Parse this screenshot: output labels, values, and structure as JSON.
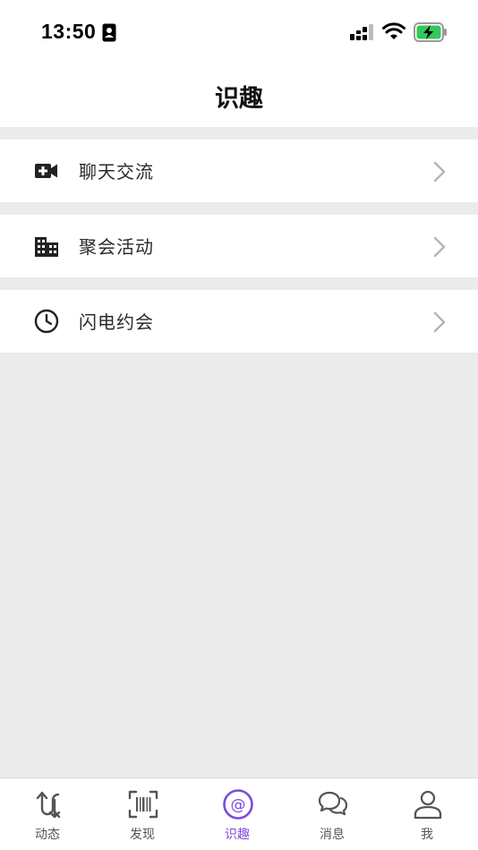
{
  "status_bar": {
    "time": "13:50",
    "icons": [
      "id-card-icon",
      "signal-icon",
      "wifi-icon",
      "battery-charging-icon"
    ],
    "battery_color": "#34c759"
  },
  "nav": {
    "title": "识趣"
  },
  "menu": {
    "items": [
      {
        "label": "聊天交流",
        "icon": "video-add-icon"
      },
      {
        "label": "聚会活动",
        "icon": "building-icon"
      },
      {
        "label": "闪电约会",
        "icon": "clock-icon"
      }
    ]
  },
  "tabs": {
    "active_color": "#7b4ae0",
    "items": [
      {
        "label": "动态",
        "icon": "arrows-updown-icon"
      },
      {
        "label": "发现",
        "icon": "barcode-scan-icon"
      },
      {
        "label": "识趣",
        "icon": "at-sign-icon",
        "active": true
      },
      {
        "label": "消息",
        "icon": "chat-bubbles-icon"
      },
      {
        "label": "我",
        "icon": "person-icon"
      }
    ]
  }
}
